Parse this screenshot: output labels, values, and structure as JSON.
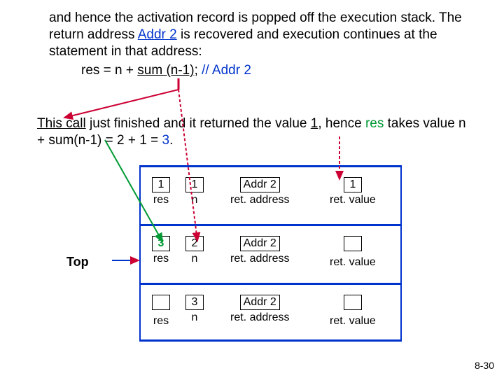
{
  "para1": "and hence the activation record is popped off the execution stack. The return address ",
  "addr2": "Addr 2",
  "para1b": " is recovered and execution continues at the statement in that address:",
  "code_pre": "res = n + ",
  "code_call": "sum (n-1);",
  "code_cmt": " // Addr 2",
  "call_a": "This call",
  "call_b": " just finished and it returned the value ",
  "call_c": "1",
  "call_d": ", hence ",
  "res_word": "res",
  "call_e": " takes value n + sum(n-1) = 2 + 1 = ",
  "three": "3",
  "call_f": ".",
  "top": "Top",
  "rows": [
    {
      "res": "1",
      "n": "1",
      "ra": "Addr 2",
      "rv": "1"
    },
    {
      "res": "3",
      "n": "2",
      "ra": "Addr 2",
      "rv": ""
    },
    {
      "res": "",
      "n": "3",
      "ra": "Addr 2",
      "rv": ""
    }
  ],
  "labels": {
    "res": "res",
    "n": "n",
    "ra": "ret. address",
    "rv": "ret. value"
  },
  "page": "8-30"
}
